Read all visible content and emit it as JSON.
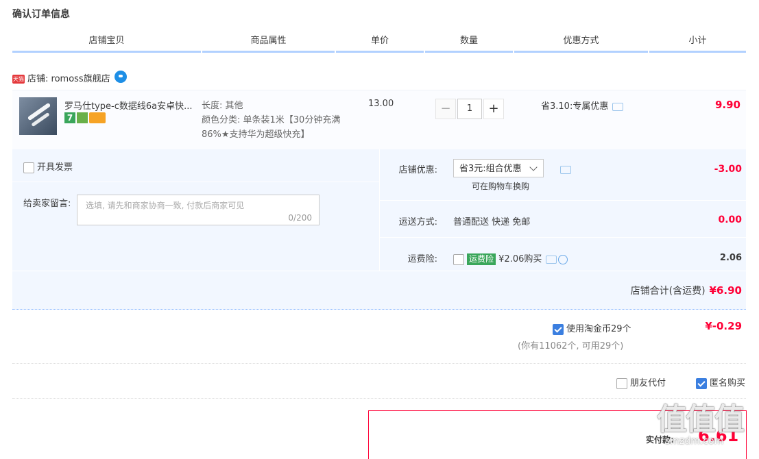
{
  "page_title": "确认订单信息",
  "columns": [
    "店铺宝贝",
    "商品属性",
    "单价",
    "数量",
    "优惠方式",
    "小计"
  ],
  "shop": {
    "tmall_badge": "天猫",
    "label": "店铺: romoss旗舰店"
  },
  "item": {
    "name": "罗马仕type-c数据线6a安卓快...",
    "badge_7": "7",
    "attr_length": "长度: 其他",
    "attr_color": "颜色分类: 单条装1米【30分钟充满86%★支持华为超级快充】",
    "unit_price": "13.00",
    "quantity": "1",
    "qty_minus": "−",
    "qty_plus": "+",
    "promo": "省3.10:专属优惠",
    "subtotal": "9.90"
  },
  "options": {
    "invoice_label": "开具发票",
    "message_label": "给卖家留言:",
    "message_placeholder": "选填, 请先和商家协商一致, 付款后商家可见",
    "message_count": "0/200",
    "shop_coupon_label": "店铺优惠:",
    "shop_coupon_value": "省3元:组合优惠",
    "shop_coupon_hint": "可在购物车换购",
    "shop_coupon_amount": "-3.00",
    "shipping_label": "运送方式:",
    "shipping_value": "普通配送 快递 免邮",
    "shipping_amount": "0.00",
    "insurance_label": "运费险:",
    "insurance_badge": "运费险",
    "insurance_price": "¥2.06购买",
    "insurance_amount": "2.06",
    "shop_total_label": "店铺合计(含运费)",
    "shop_total_value": "¥6.90"
  },
  "coins": {
    "label": "使用淘金币29个",
    "sub": "(你有11062个, 可用29个)",
    "value": "¥-0.29",
    "checked": true
  },
  "extra": {
    "friend_pay": "朋友代付",
    "anonymous": "匿名购买",
    "anonymous_checked": true
  },
  "payment": {
    "label": "实付款:",
    "amount": "6.61"
  },
  "watermark": {
    "big": "值值值",
    "small": "smzdm.com"
  }
}
